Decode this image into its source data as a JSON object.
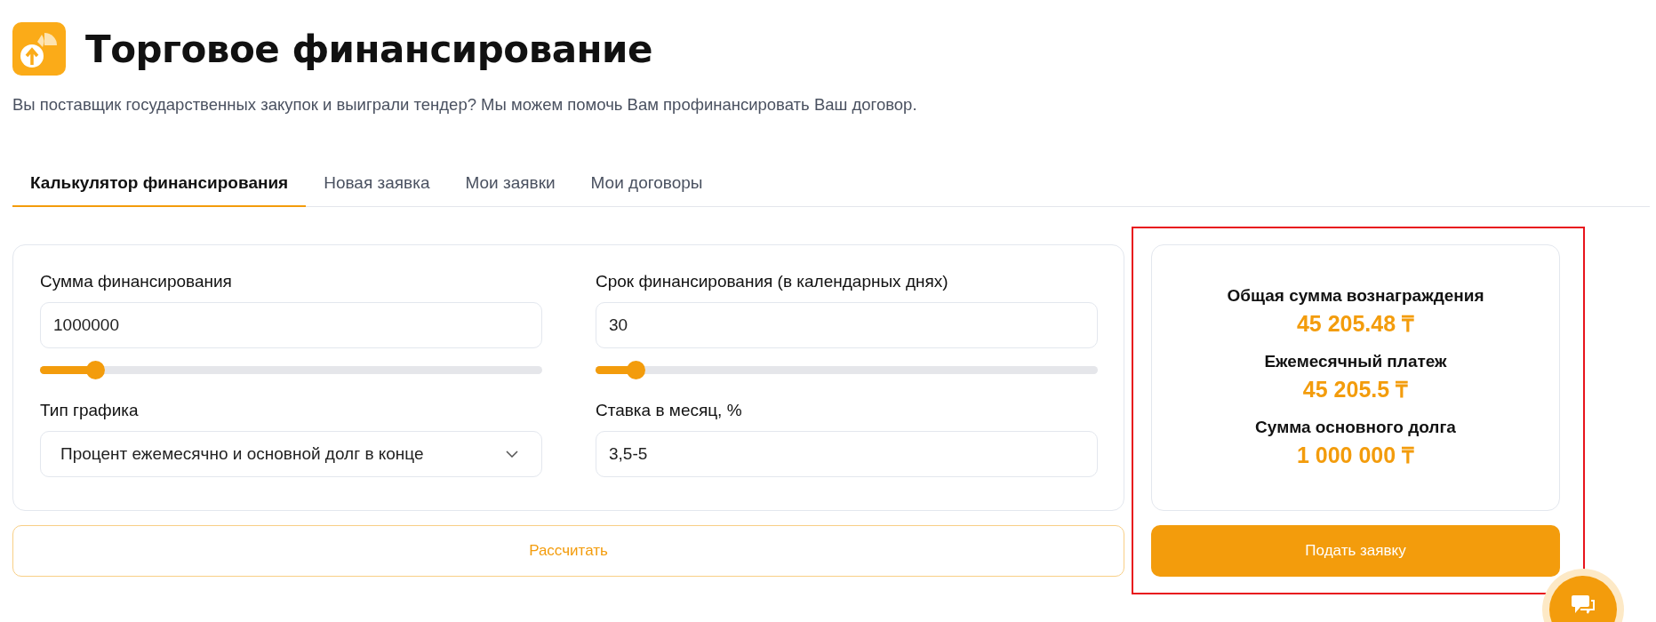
{
  "header": {
    "title": "Торговое финансирование",
    "subtitle": "Вы поставщик государственных закупок и выиграли тендер? Мы можем помочь Вам профинансировать Ваш договор."
  },
  "tabs": [
    {
      "label": "Калькулятор финансирования",
      "selected": true
    },
    {
      "label": "Новая заявка",
      "selected": false
    },
    {
      "label": "Мои заявки",
      "selected": false
    },
    {
      "label": "Мои договоры",
      "selected": false
    }
  ],
  "form": {
    "fields": [
      {
        "kind": "slider",
        "label": "Сумма финансирования",
        "value": "1000000",
        "level": 0.11
      },
      {
        "kind": "slider",
        "label": "Срок финансирования (в календарных днях)",
        "value": "30",
        "level": 0.08
      },
      {
        "kind": "select",
        "label": "Тип графика",
        "value": "Процент ежемесячно и основной долг в конце"
      },
      {
        "kind": "text",
        "label": "Ставка в месяц, %",
        "value": "3,5-5"
      }
    ],
    "calculate_button": "Рассчитать"
  },
  "summary": {
    "items": [
      {
        "label": "Общая сумма вознаграждения",
        "value": "45 205.48 ₸"
      },
      {
        "label": "Ежемесячный платеж",
        "value": "45 205.5 ₸"
      },
      {
        "label": "Сумма основного долга",
        "value": "1 000 000 ₸"
      }
    ],
    "submit_button": "Подать заявку"
  }
}
